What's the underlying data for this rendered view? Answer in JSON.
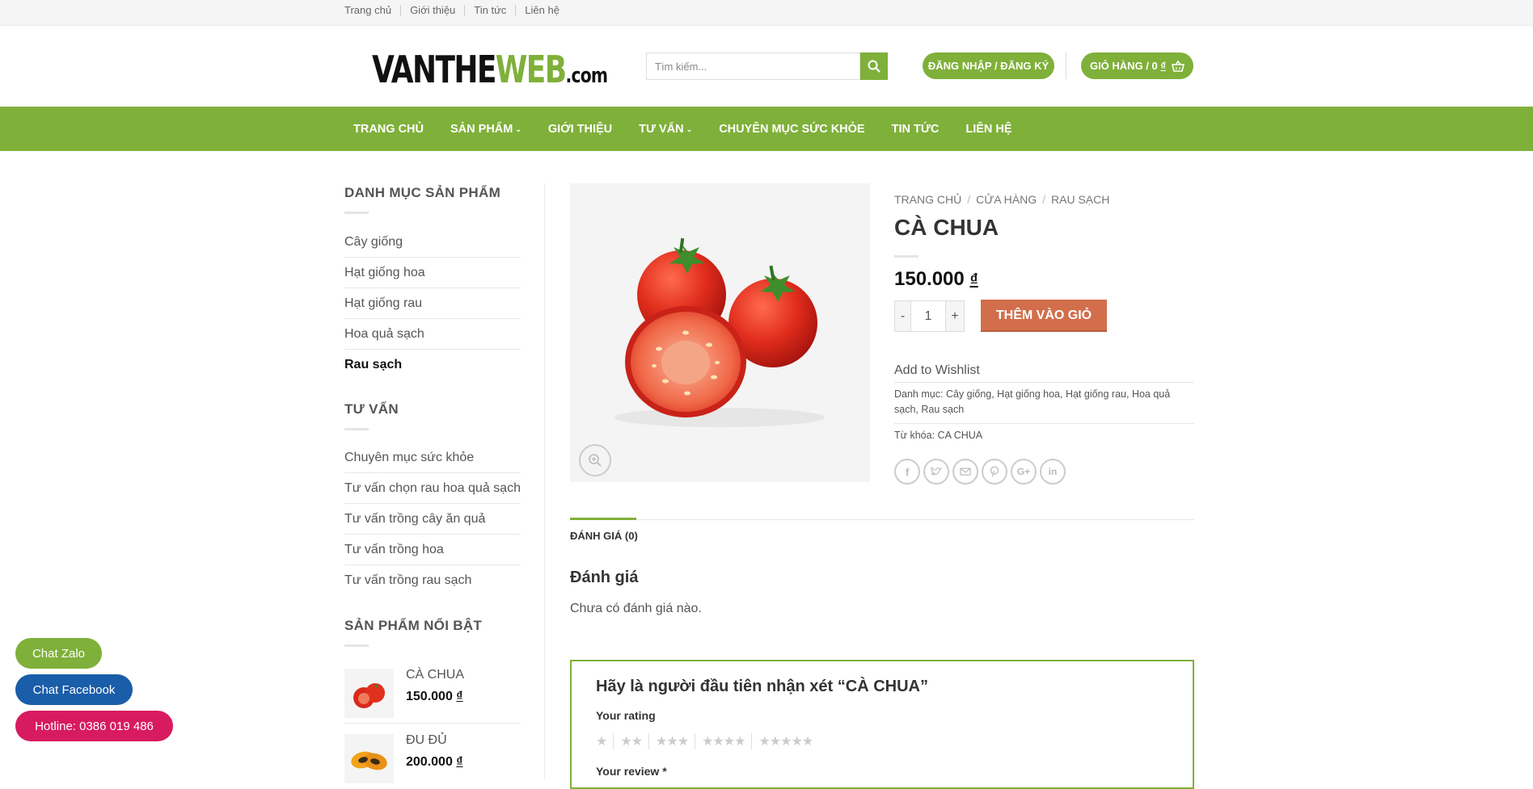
{
  "topbar": {
    "links": [
      "Trang chủ",
      "Giới thiệu",
      "Tin tức",
      "Liên hệ"
    ]
  },
  "header": {
    "logo": {
      "part1": "VANTHE",
      "part2": "WEB",
      "part3": ".com"
    },
    "search_placeholder": "Tìm kiếm...",
    "login_label": "ĐĂNG NHẬP / ĐĂNG KÝ",
    "cart_label": "GIỎ HÀNG / 0",
    "cart_currency": "₫"
  },
  "mainnav": {
    "items": [
      "TRANG CHỦ",
      "SẢN PHẨM",
      "GIỚI THIỆU",
      "TƯ VẤN",
      "CHUYÊN MỤC SỨC KHỎE",
      "TIN TỨC",
      "LIÊN HỆ"
    ]
  },
  "sidebar": {
    "categories_title": "DANH MỤC SẢN PHẨM",
    "categories": [
      "Cây giống",
      "Hạt giống hoa",
      "Hạt giống rau",
      "Hoa quả sạch",
      "Rau sạch"
    ],
    "advice_title": "TƯ VẤN",
    "advice": [
      "Chuyên mục sức khỏe",
      "Tư vấn chọn rau hoa quả sạch",
      "Tư vấn trồng cây ăn quả",
      "Tư vấn trồng hoa",
      "Tư vấn trồng rau sạch"
    ],
    "featured_title": "SẢN PHẨM NỔI BẬT",
    "featured": [
      {
        "name": "CÀ CHUA",
        "price": "150.000",
        "currency": "₫"
      },
      {
        "name": "ĐU ĐỦ",
        "price": "200.000",
        "currency": "₫"
      }
    ]
  },
  "product": {
    "breadcrumb": [
      "TRANG CHỦ",
      "CỬA HÀNG",
      "RAU SẠCH"
    ],
    "title": "CÀ CHUA",
    "price": "150.000",
    "currency": "₫",
    "qty_minus": "-",
    "qty_value": "1",
    "qty_plus": "+",
    "add_to_cart": "THÊM VÀO GIỎ",
    "wishlist": "Add to Wishlist",
    "category_label": "Danh mục:",
    "categories_line1": "Cây giống, Hạt giống hoa, Hạt giống rau, Hoa quả",
    "categories_line2": "sạch, Rau sạch",
    "tag_label": "Từ khóa:",
    "tag": "CA CHUA",
    "share_icons": [
      "facebook-icon",
      "twitter-icon",
      "email-icon",
      "pinterest-icon",
      "google-plus-icon",
      "linkedin-icon"
    ]
  },
  "reviews": {
    "tab": "ĐÁNH GIÁ (0)",
    "heading": "Đánh giá",
    "none": "Chưa có đánh giá nào.",
    "form_title": "Hãy là người đầu tiên nhận xét “CÀ CHUA”",
    "rating_label": "Your rating",
    "review_label": "Your review *",
    "star_groups": [
      1,
      2,
      3,
      4,
      5
    ]
  },
  "floating": {
    "zalo": "Chat Zalo",
    "facebook": "Chat Facebook",
    "hotline": "Hotline: 0386 019 486"
  },
  "colors": {
    "accent": "#7fb03a",
    "cart_button": "#d26e4b",
    "facebook": "#1a5da8",
    "hotline": "#d81b60",
    "zalo": "#7fb03a"
  }
}
